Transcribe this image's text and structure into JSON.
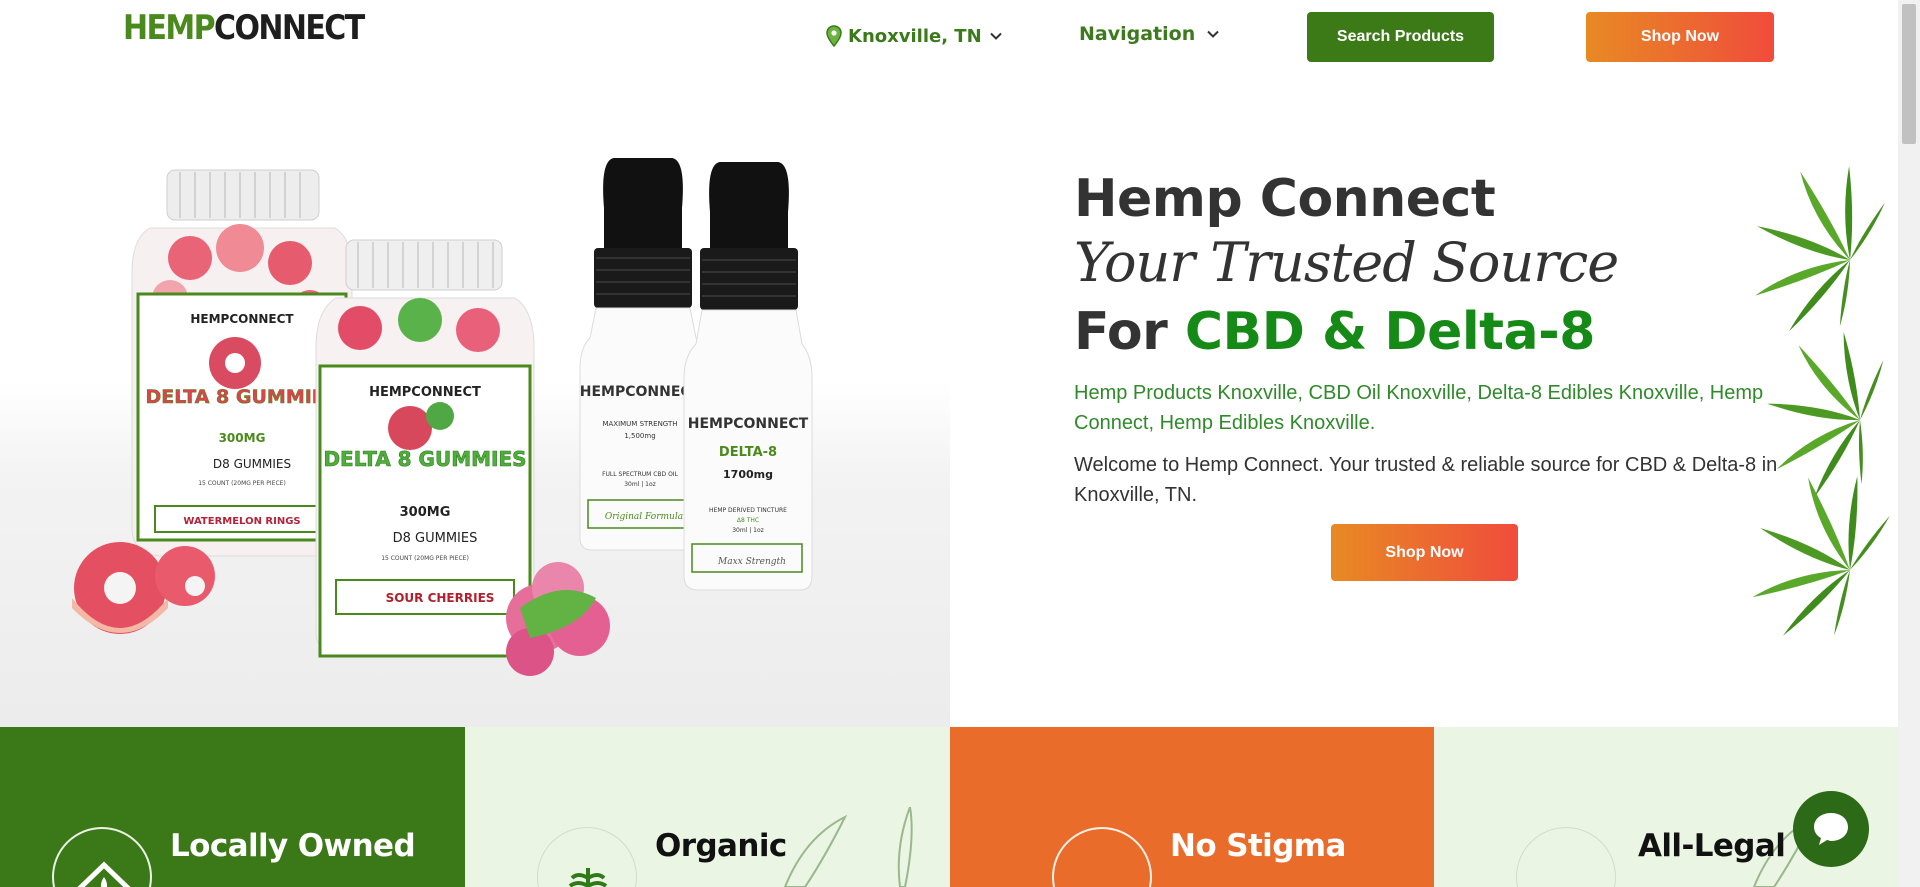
{
  "header": {
    "logo_alt": "HEMPCONNECT",
    "logo_hemp": "HEMP",
    "logo_connect": "CONNECT",
    "location_label": "Knoxville, TN",
    "nav_label": "Navigation",
    "search_button": "Search Products",
    "shop_button": "Shop Now"
  },
  "hero": {
    "title_line1": "Hemp Connect",
    "title_line2": "Your Trusted Source",
    "title_line3_prefix": "For ",
    "title_line3_highlight": "CBD & Delta-8",
    "keywords": "Hemp Products Knoxville, CBD Oil Knoxville, Delta-8 Edibles Knoxville, Hemp Connect, Hemp Edibles Knoxville.",
    "welcome": "Welcome to Hemp Connect. Your trusted & reliable source for CBD & Delta-8 in Knoxville, TN.",
    "shop_button": "Shop Now",
    "products": {
      "brand": "HEMPCONNECT",
      "gummy1_name": "DELTA 8 GUMMIES",
      "gummy1_dose": "300MG",
      "gummy1_type": "D8 GUMMIES",
      "gummy1_count": "15 COUNT (20MG PER PIECE)",
      "gummy1_flavor": "WATERMELON RINGS",
      "gummy2_name": "DELTA 8 GUMMIES",
      "gummy2_dose": "300MG",
      "gummy2_type": "D8 GUMMIES",
      "gummy2_count": "15 COUNT (20MG PER PIECE)",
      "gummy2_flavor": "SOUR CHERRIES",
      "tincture1_strength": "MAXIMUM STRENGTH",
      "tincture1_mg": "1,500mg",
      "tincture1_type": "FULL SPECTRUM CBD OIL",
      "tincture1_size": "30ml | 1oz",
      "tincture1_script": "Original Formula",
      "tincture2_name": "DELTA-8",
      "tincture2_mg": "1700mg",
      "tincture2_type": "HEMP DERIVED TINCTURE",
      "tincture2_sub": "Δ8 THC",
      "tincture2_size": "30ml | 1oz",
      "tincture2_script": "Maxx Strength"
    }
  },
  "features": [
    {
      "title": "Locally Owned",
      "icon": "home-leaf-icon",
      "color": "#3b7818"
    },
    {
      "title": "Organic",
      "icon": "plant-icon",
      "color": "#eaf5e4"
    },
    {
      "title": "No Stigma",
      "icon": "no-stigma-icon",
      "color": "#e96c2a"
    },
    {
      "title": "All-Legal",
      "icon": "legal-icon",
      "color": "#eaf5e4"
    }
  ],
  "colors": {
    "brand_green": "#3c7a17",
    "accent_green": "#168a17",
    "orange_start": "#e88a24",
    "orange_end": "#f04c3c"
  },
  "chat": {
    "icon": "chat-bubble-icon"
  }
}
